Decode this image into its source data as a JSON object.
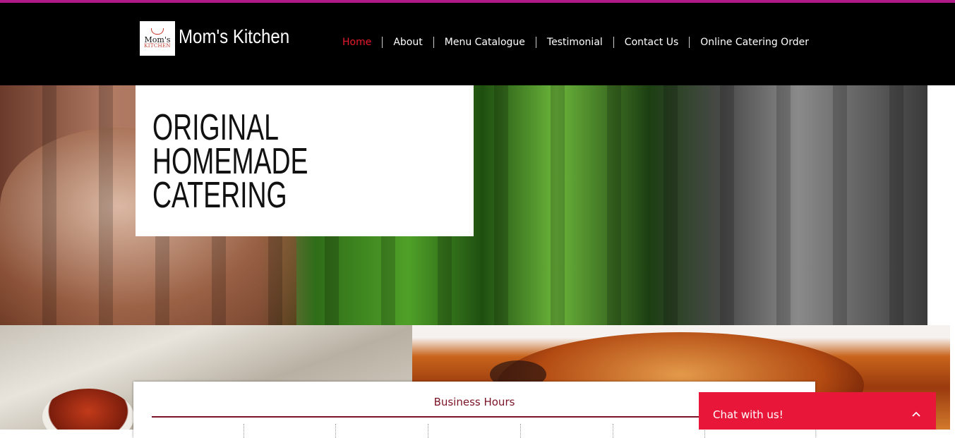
{
  "header": {
    "logo_line1": "Mom's",
    "logo_line2": "KITCHEN",
    "brand": "Mom's Kitchen",
    "nav": [
      {
        "label": "Home",
        "active": true
      },
      {
        "label": "About"
      },
      {
        "label": "Menu Catalogue"
      },
      {
        "label": "Testimonial"
      },
      {
        "label": "Contact Us"
      },
      {
        "label": "Online Catering Order"
      }
    ]
  },
  "hero": {
    "title": "ORIGINAL\nHOMEMADE\nCATERING"
  },
  "hours": {
    "title": "Business Hours"
  },
  "chat": {
    "label": "Chat with us!"
  },
  "colors": {
    "accent_stripe": "#b01a88",
    "nav_active": "#e8192c",
    "hours_title": "#7b1326",
    "chat_bg": "#e8173a"
  }
}
